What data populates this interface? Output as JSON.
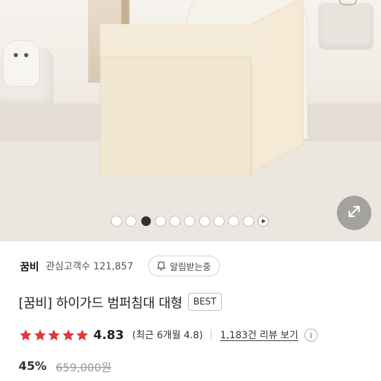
{
  "gallery": {
    "image_alt": "beige bumper bed product photo",
    "slide_count": 10,
    "active_index": 2,
    "play_icon": "play-icon",
    "expand_icon": "expand-arrows-icon"
  },
  "seller": {
    "brand": "꿈비",
    "fans_text": "관심고객수 121,857",
    "notify_label": "알림받는중",
    "notify_icon": "bell-icon"
  },
  "product": {
    "title": "[꿈비] 하이가드 범퍼침대 대형",
    "badge": "BEST"
  },
  "rating": {
    "stars": 5,
    "score": "4.83",
    "recent": "(최근 6개월 4.8)",
    "reviews_link": "1,183건 리뷰 보기",
    "info_icon": "info-icon",
    "star_color": "#e0393e"
  },
  "price": {
    "discount": "45%",
    "original": "659,000원"
  }
}
